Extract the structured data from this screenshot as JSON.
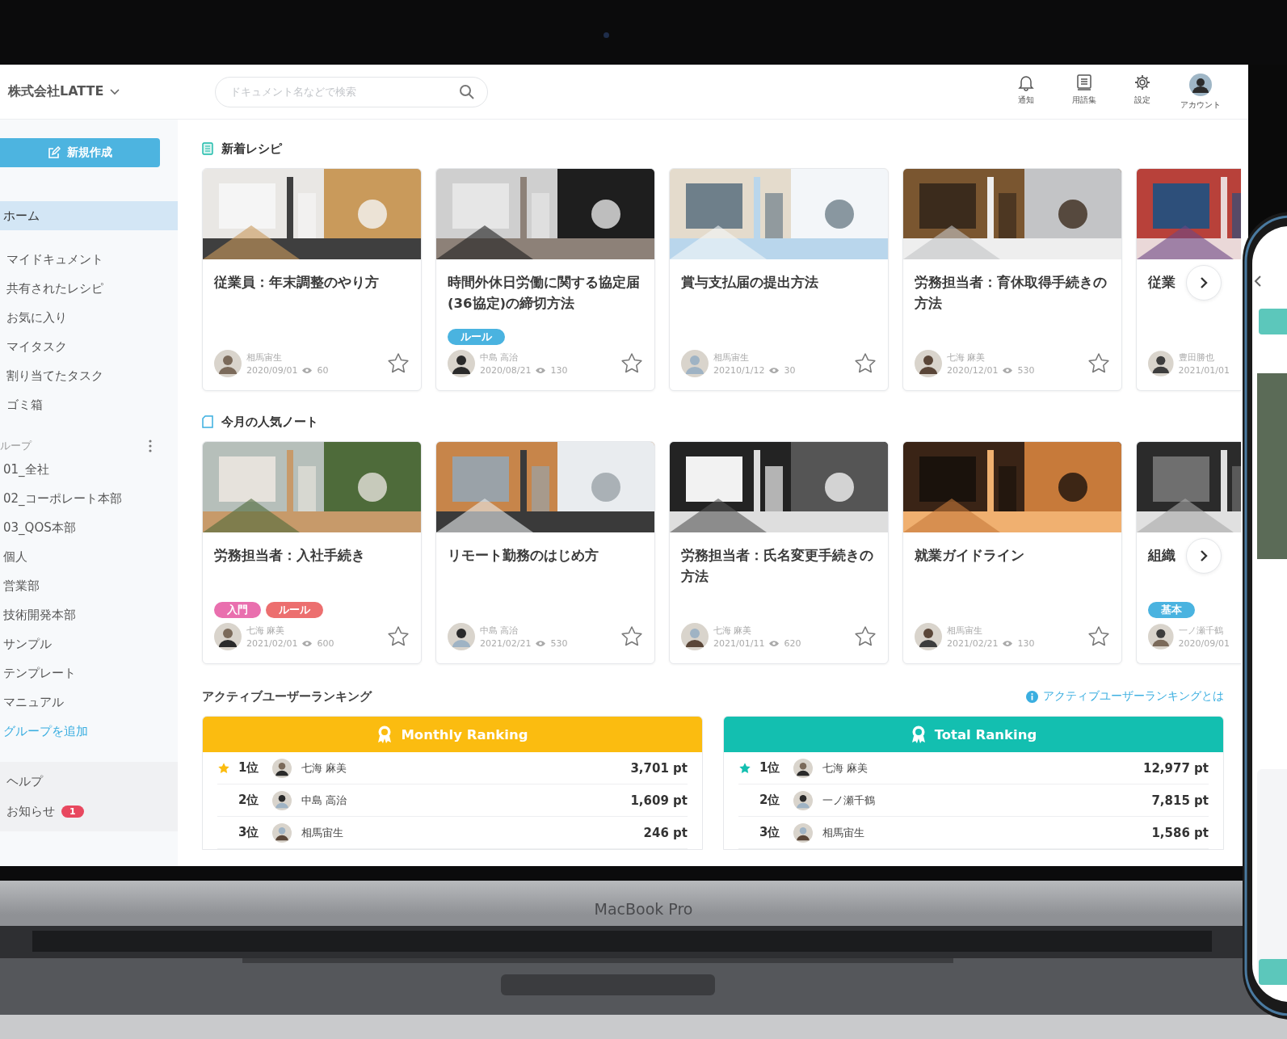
{
  "device": {
    "label": "MacBook Pro"
  },
  "header": {
    "company": "株式会社LATTE",
    "search": {
      "placeholder": "ドキュメント名などで検索"
    },
    "actions": [
      {
        "kind": "bell",
        "label": "通知"
      },
      {
        "kind": "book",
        "label": "用語集"
      },
      {
        "kind": "gear",
        "label": "設定"
      },
      {
        "kind": "avatar",
        "label": "アカウント"
      }
    ]
  },
  "sidebar": {
    "new_button": "新規作成",
    "nav": [
      {
        "label": "ホーム",
        "selected": true
      },
      {
        "label": "マイドキュメント",
        "selected": false
      },
      {
        "label": "共有されたレシピ",
        "selected": false
      },
      {
        "label": "お気に入り",
        "selected": false
      },
      {
        "label": "マイタスク",
        "selected": false
      },
      {
        "label": "割り当てたタスク",
        "selected": false
      },
      {
        "label": "ゴミ箱",
        "selected": false
      }
    ],
    "group_heading": "ループ",
    "groups": [
      {
        "label": "01_全社",
        "selected": false
      },
      {
        "label": "02_コーポレート本部",
        "selected": false
      },
      {
        "label": "03_QOS本部",
        "selected": false
      },
      {
        "label": "個人",
        "selected": false
      },
      {
        "label": "営業部",
        "selected": false
      },
      {
        "label": "技術開発本部",
        "selected": false
      },
      {
        "label": "サンプル",
        "selected": false
      },
      {
        "label": "テンプレート",
        "selected": false
      },
      {
        "label": "マニュアル",
        "selected": false
      }
    ],
    "add_group": "グループを追加",
    "help": [
      {
        "label": "ヘルプ"
      },
      {
        "label": "お知らせ",
        "badge": "1"
      }
    ]
  },
  "sections": [
    {
      "kind": "recipe",
      "title": "新着レシピ",
      "cards": [
        {
          "title": "従業員：年末調整のやり方",
          "author": "相馬宙生",
          "date": "2020/09/01",
          "views": "60"
        },
        {
          "title": "時間外休日労働に関する協定届(36協定)の締切方法",
          "tags": [
            {
              "label": "ルール",
              "color": "#4ab3e0"
            }
          ],
          "author": "中島 高治",
          "date": "2020/08/21",
          "views": "130"
        },
        {
          "title": "賞与支払届の提出方法",
          "author": "相馬宙生",
          "date": "20210/1/12",
          "views": "30"
        },
        {
          "title": "労務担当者：育休取得手続きの方法",
          "author": "七海 麻美",
          "date": "2020/12/01",
          "views": "530"
        },
        {
          "title": "従業",
          "author": "豊田勝也",
          "date": "2021/01/01",
          "partial": true
        }
      ]
    },
    {
      "kind": "note",
      "title": "今月の人気ノート",
      "cards": [
        {
          "title": "労務担当者：入社手続き",
          "tags": [
            {
              "label": "入門",
              "color": "#e96fae"
            },
            {
              "label": "ルール",
              "color": "#ec6f6f"
            }
          ],
          "author": "七海 麻美",
          "date": "2021/02/01",
          "views": "600"
        },
        {
          "title": "リモート勤務のはじめ方",
          "author": "中島 高治",
          "date": "2021/02/21",
          "views": "530"
        },
        {
          "title": "労務担当者：氏名変更手続きの方法",
          "author": "七海 麻美",
          "date": "2021/01/11",
          "views": "620"
        },
        {
          "title": "就業ガイドライン",
          "author": "相馬宙生",
          "date": "2021/02/21",
          "views": "130"
        },
        {
          "title": "組織",
          "tags": [
            {
              "label": "基本",
              "color": "#4ab3e0"
            }
          ],
          "author": "一ノ瀬千鶴",
          "date": "2020/09/01",
          "partial": true
        }
      ]
    }
  ],
  "ranking": {
    "title": "アクティブユーザーランキング",
    "help_link": "アクティブユーザーランキングとは",
    "panels": [
      {
        "title": "Monthly Ranking",
        "color": "#fbbc10",
        "rows": [
          {
            "star": true,
            "rank": "1位",
            "name": "七海 麻美",
            "points": "3,701 pt"
          },
          {
            "star": false,
            "rank": "2位",
            "name": "中島 高治",
            "points": "1,609 pt"
          },
          {
            "star": false,
            "rank": "3位",
            "name": "相馬宙生",
            "points": "246 pt"
          }
        ]
      },
      {
        "title": "Total Ranking",
        "color": "#13bfb0",
        "rows": [
          {
            "star": true,
            "rank": "1位",
            "name": "七海 麻美",
            "points": "12,977 pt"
          },
          {
            "star": false,
            "rank": "2位",
            "name": "一ノ瀬千鶴",
            "points": "7,815 pt"
          },
          {
            "star": false,
            "rank": "3位",
            "name": "相馬宙生",
            "points": "1,586 pt"
          }
        ]
      }
    ]
  }
}
